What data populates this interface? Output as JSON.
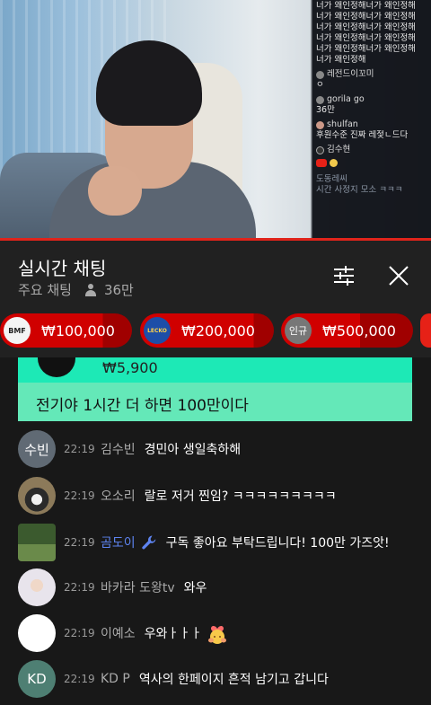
{
  "video": {
    "mini_chat": {
      "repeat_lines": [
        "너가 왜인정해너가 왜인정해",
        "너가 왜인정해너가 왜인정해",
        "너가 왜인정해너가 왜인정해",
        "너가 왜인정해너가 왜인정해",
        "너가 왜인정해너가 왜인정해",
        "너가 왜인정해"
      ],
      "entries": [
        {
          "user": "레전드이꼬미",
          "text": "ㅇ"
        },
        {
          "user": "gorila go",
          "text": "36만"
        },
        {
          "user": "shulfan",
          "text": "후원수준 진짜 레젗ㄴ드다"
        },
        {
          "user": "김수현",
          "text": ""
        }
      ],
      "faded_user": "도동레씨",
      "faded_text": "시간 사정지 모소 ㅋㅋㅋ"
    }
  },
  "header": {
    "title": "실시간 채팅",
    "mode": "주요 채팅",
    "viewers": "36만",
    "filter_icon": "tune-icon",
    "close_icon": "close-icon"
  },
  "ticker": [
    {
      "avatar": "BMF",
      "amount": "₩100,000"
    },
    {
      "avatar": "LECKO",
      "amount": "₩200,000"
    },
    {
      "avatar": "인규",
      "amount": "₩500,000"
    }
  ],
  "super_chat": {
    "amount": "₩5,900",
    "message": "전기야 1시간 더 하면 100만이다",
    "color": "#64e8b8"
  },
  "messages": [
    {
      "avatar_text": "수빈",
      "avatar_color": "#606a74",
      "time": "22:19",
      "author": "김수빈",
      "text": "경민아 생일축하해"
    },
    {
      "avatar_text": "",
      "avatar_color": "#7a6a52",
      "time": "22:19",
      "author": "오소리",
      "text": "랄로 저거 찐임? ㅋㅋㅋㅋㅋㅋㅋㅋㅋ"
    },
    {
      "avatar_text": "",
      "avatar_color": "#4a6a3a",
      "time": "22:19",
      "author": "곰도이",
      "text": "구독 좋아요 부탁드립니다! 100만 가즈앗!",
      "moderator": true
    },
    {
      "avatar_text": "",
      "avatar_color": "#e8e4ec",
      "time": "22:19",
      "author": "바카라 도왕tv",
      "text": "와우"
    },
    {
      "avatar_text": "",
      "avatar_color": "#ffffff",
      "time": "22:19",
      "author": "이예소",
      "text": "우와ㅏㅏㅏ"
    },
    {
      "avatar_text": "KD",
      "avatar_color": "#4e7f73",
      "time": "22:19",
      "author": "KD P",
      "text": "역사의 한페이지 흔적 남기고 갑니다"
    }
  ]
}
